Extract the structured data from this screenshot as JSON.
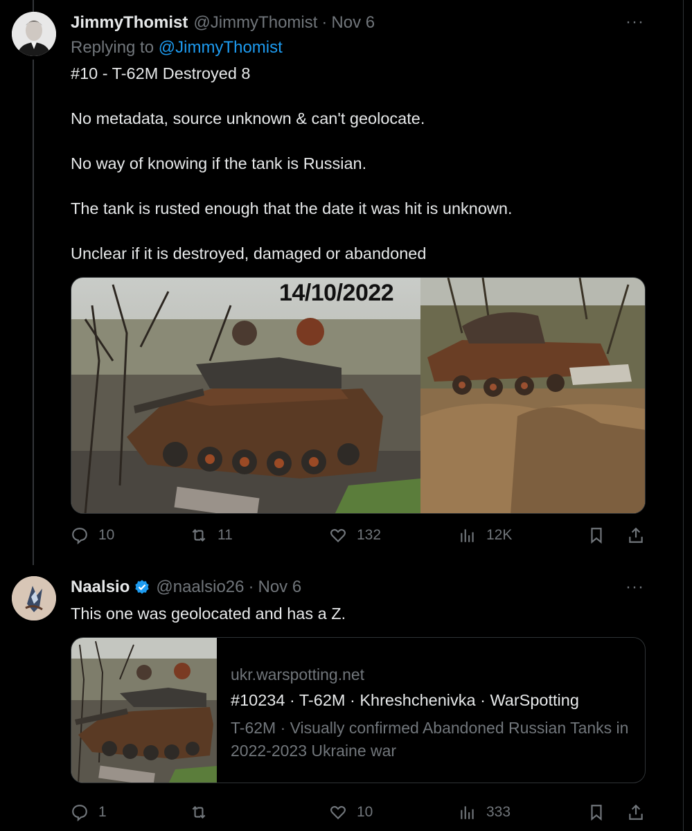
{
  "tweets": [
    {
      "name": "JimmyThomist",
      "handle": "@JimmyThomist",
      "dot": "·",
      "date": "Nov 6",
      "reply_prefix": "Replying to ",
      "reply_to": "@JimmyThomist",
      "more": "···",
      "paragraphs": [
        "#10 - T-62M Destroyed 8",
        "No metadata, source unknown & can't geolocate.",
        "No way of knowing if the tank is Russian.",
        "The tank is rusted enough that the date it was hit is unknown.",
        "Unclear if it is destroyed, damaged or abandoned"
      ],
      "media_overlay_text": "14/10/2022",
      "stats": {
        "replies": "10",
        "retweets": "11",
        "likes": "132",
        "views": "12K"
      }
    },
    {
      "name": "Naalsio",
      "handle": "@naalsio26",
      "dot": "·",
      "date": "Nov 6",
      "more": "···",
      "text": "This one was geolocated and has a Z.",
      "card": {
        "domain": "ukr.warspotting.net",
        "title": "#10234 · T-62M · Khreshchenivka · WarSpotting",
        "description": "T-62M · Visually confirmed Abandoned Russian Tanks in 2022-2023 Ukraine war"
      },
      "stats": {
        "replies": "1",
        "retweets": "",
        "likes": "10",
        "views": "333"
      }
    }
  ],
  "colors": {
    "background": "#000000",
    "text": "#e7e9ea",
    "muted": "#71767b",
    "link": "#1d9bf0",
    "border": "#2f3336"
  }
}
